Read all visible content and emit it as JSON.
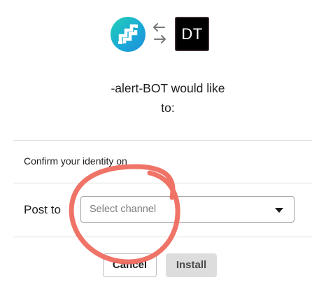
{
  "header": {
    "app_logo_icon": "app-logo-pipes-icon",
    "swap_icon": "arrows-left-right-icon",
    "workspace_logo_text": "DT"
  },
  "dialog": {
    "title_line1": "-alert-BOT would like",
    "title_line2": "to:",
    "confirm_text": "Confirm your identity on",
    "post_label": "Post to",
    "select": {
      "placeholder": "Select channel",
      "caret_icon": "caret-down-icon"
    },
    "buttons": {
      "cancel": "Cancel",
      "install": "Install"
    }
  },
  "annotation": {
    "type": "hand-drawn circle",
    "color": "#ee6b5f"
  },
  "colors": {
    "text": "#1d1c1d",
    "divider": "#dddddd",
    "install_bg": "#dddddd",
    "logo_gradient_start": "#22d0b5",
    "logo_gradient_end": "#1f8fd6"
  }
}
